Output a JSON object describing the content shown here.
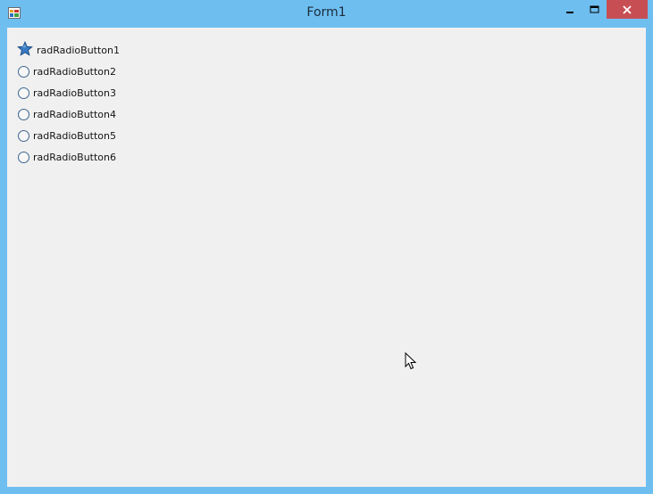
{
  "window": {
    "title": "Form1",
    "icon": "winforms-app-icon"
  },
  "caption_buttons": {
    "minimize_icon": "minimize-icon",
    "maximize_icon": "maximize-icon",
    "close_icon": "close-icon",
    "close_color": "#c74f53"
  },
  "radio_buttons": [
    {
      "label": "radRadioButton1",
      "checked": true,
      "icon": "star-icon"
    },
    {
      "label": "radRadioButton2",
      "checked": false
    },
    {
      "label": "radRadioButton3",
      "checked": false
    },
    {
      "label": "radRadioButton4",
      "checked": false
    },
    {
      "label": "radRadioButton5",
      "checked": false
    },
    {
      "label": "radRadioButton6",
      "checked": false
    }
  ],
  "colors": {
    "frame": "#6ebef0",
    "client": "#f0f0f0",
    "radio_border": "#3d6790",
    "star_fill": "#3a7ac4"
  },
  "cursor_icon": "mouse-pointer-icon"
}
